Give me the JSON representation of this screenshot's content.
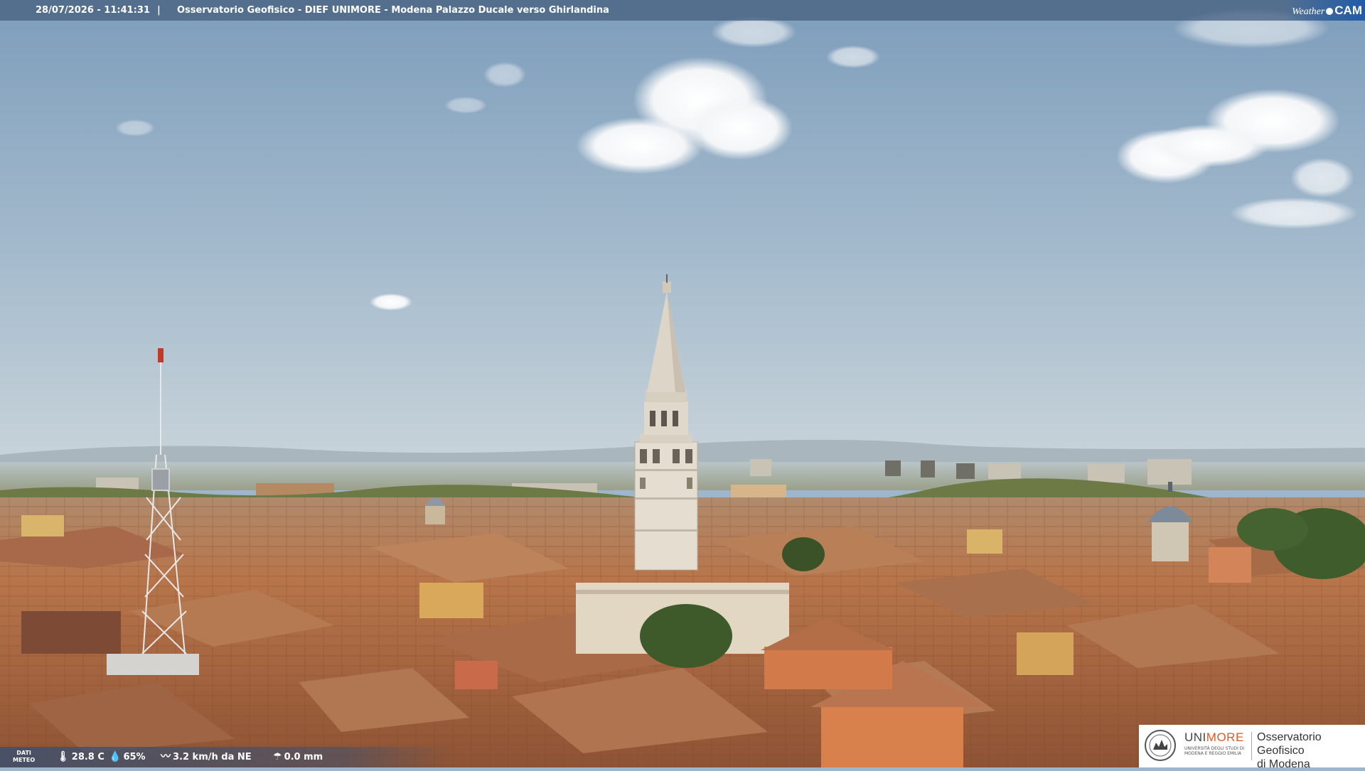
{
  "header": {
    "datetime": "28/07/2026 - 11:41:31",
    "separator": "|",
    "camera_title": "Osservatorio Geofisico - DIEF UNIMORE - Modena Palazzo Ducale verso Ghirlandina"
  },
  "weathercam_logo": {
    "word1": "Weather",
    "word2": "CAM"
  },
  "meteo": {
    "label_line1": "DATI",
    "label_line2": "METEO",
    "temperature": "28.8 C",
    "humidity": "65%",
    "wind": "3.2 km/h da NE",
    "rain": "0.0 mm",
    "icons": [
      "thermometer-icon",
      "humidity-drop-icon",
      "wind-icon",
      "rain-icon"
    ]
  },
  "unimore_logo": {
    "brand_a": "UNI",
    "brand_b": "MORE",
    "brand_sub": "UNIVERSITÀ DEGLI STUDI DI MODENA E REGGIO EMILIA",
    "observatory_line1": "Osservatorio Geofisico",
    "observatory_line2": "di Modena"
  },
  "colors": {
    "sky_top": "#7f9fbc",
    "sky_horizon": "#c7d3da",
    "roof_terracotta": "#b8744a",
    "tower_marble": "#e4ddd0",
    "brand_orange": "#e05a28"
  }
}
